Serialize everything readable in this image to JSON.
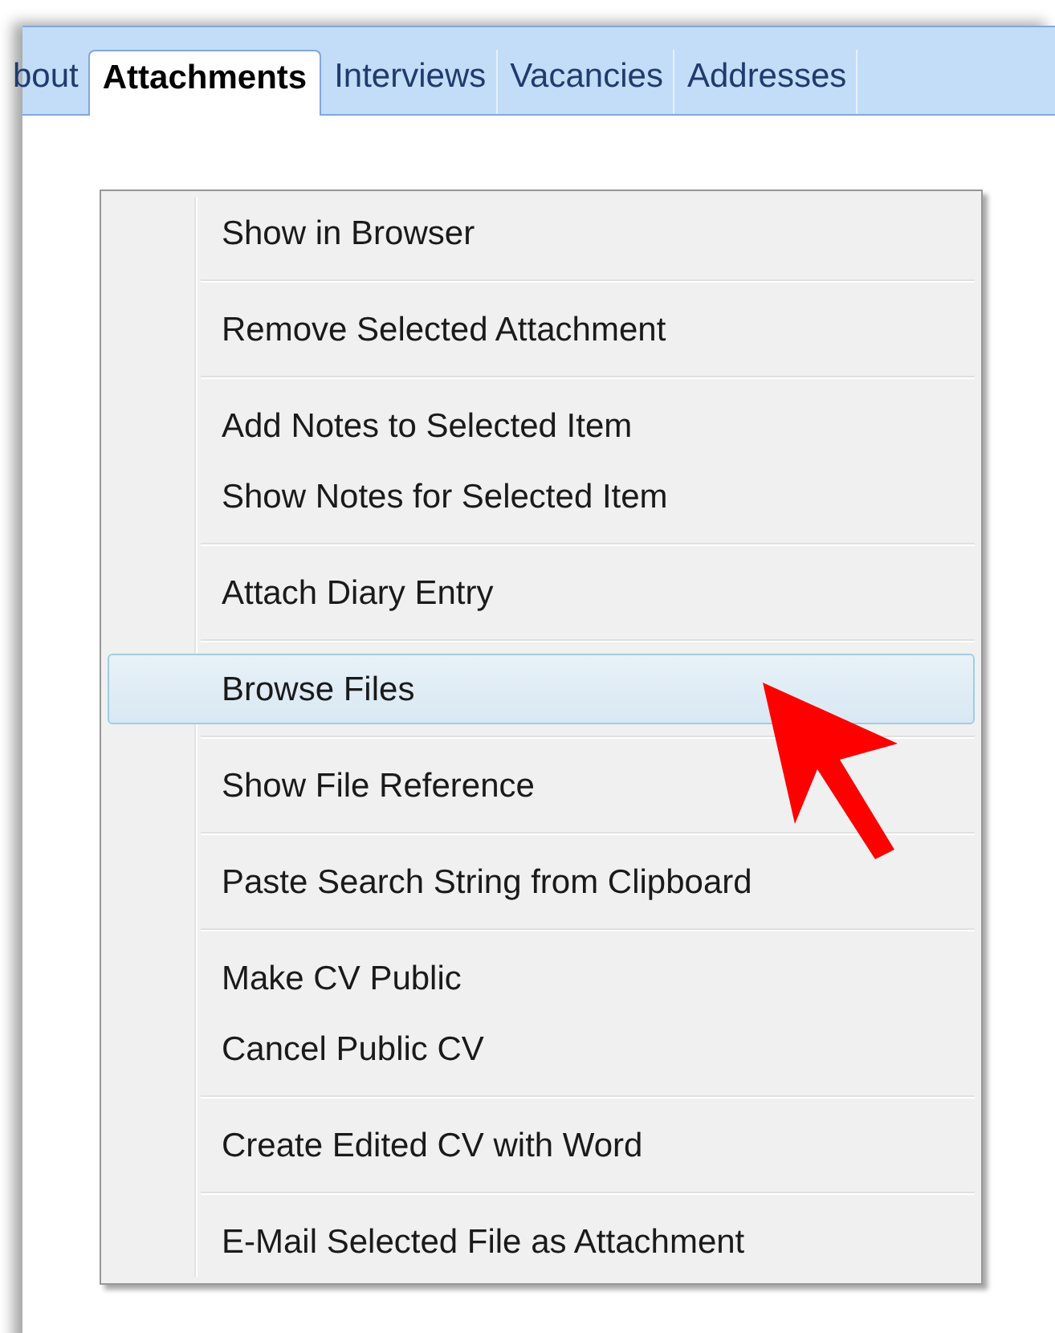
{
  "tabs": [
    {
      "label": "bout",
      "selected": false
    },
    {
      "label": "Attachments",
      "selected": true
    },
    {
      "label": "Interviews",
      "selected": false
    },
    {
      "label": "Vacancies",
      "selected": false
    },
    {
      "label": "Addresses",
      "selected": false
    }
  ],
  "context_menu": {
    "groups": [
      [
        {
          "label": "Show in Browser",
          "selected": false
        }
      ],
      [
        {
          "label": "Remove Selected Attachment",
          "selected": false
        }
      ],
      [
        {
          "label": "Add Notes to Selected Item",
          "selected": false
        },
        {
          "label": "Show Notes for Selected Item",
          "selected": false
        }
      ],
      [
        {
          "label": "Attach Diary Entry",
          "selected": false
        }
      ],
      [
        {
          "label": "Browse Files",
          "selected": true
        }
      ],
      [
        {
          "label": "Show File Reference",
          "selected": false
        }
      ],
      [
        {
          "label": "Paste Search String from Clipboard",
          "selected": false
        }
      ],
      [
        {
          "label": "Make CV Public",
          "selected": false
        },
        {
          "label": "Cancel Public CV",
          "selected": false
        }
      ],
      [
        {
          "label": "Create Edited CV with Word",
          "selected": false
        }
      ],
      [
        {
          "label": "E-Mail Selected File as Attachment",
          "selected": false
        }
      ]
    ]
  }
}
